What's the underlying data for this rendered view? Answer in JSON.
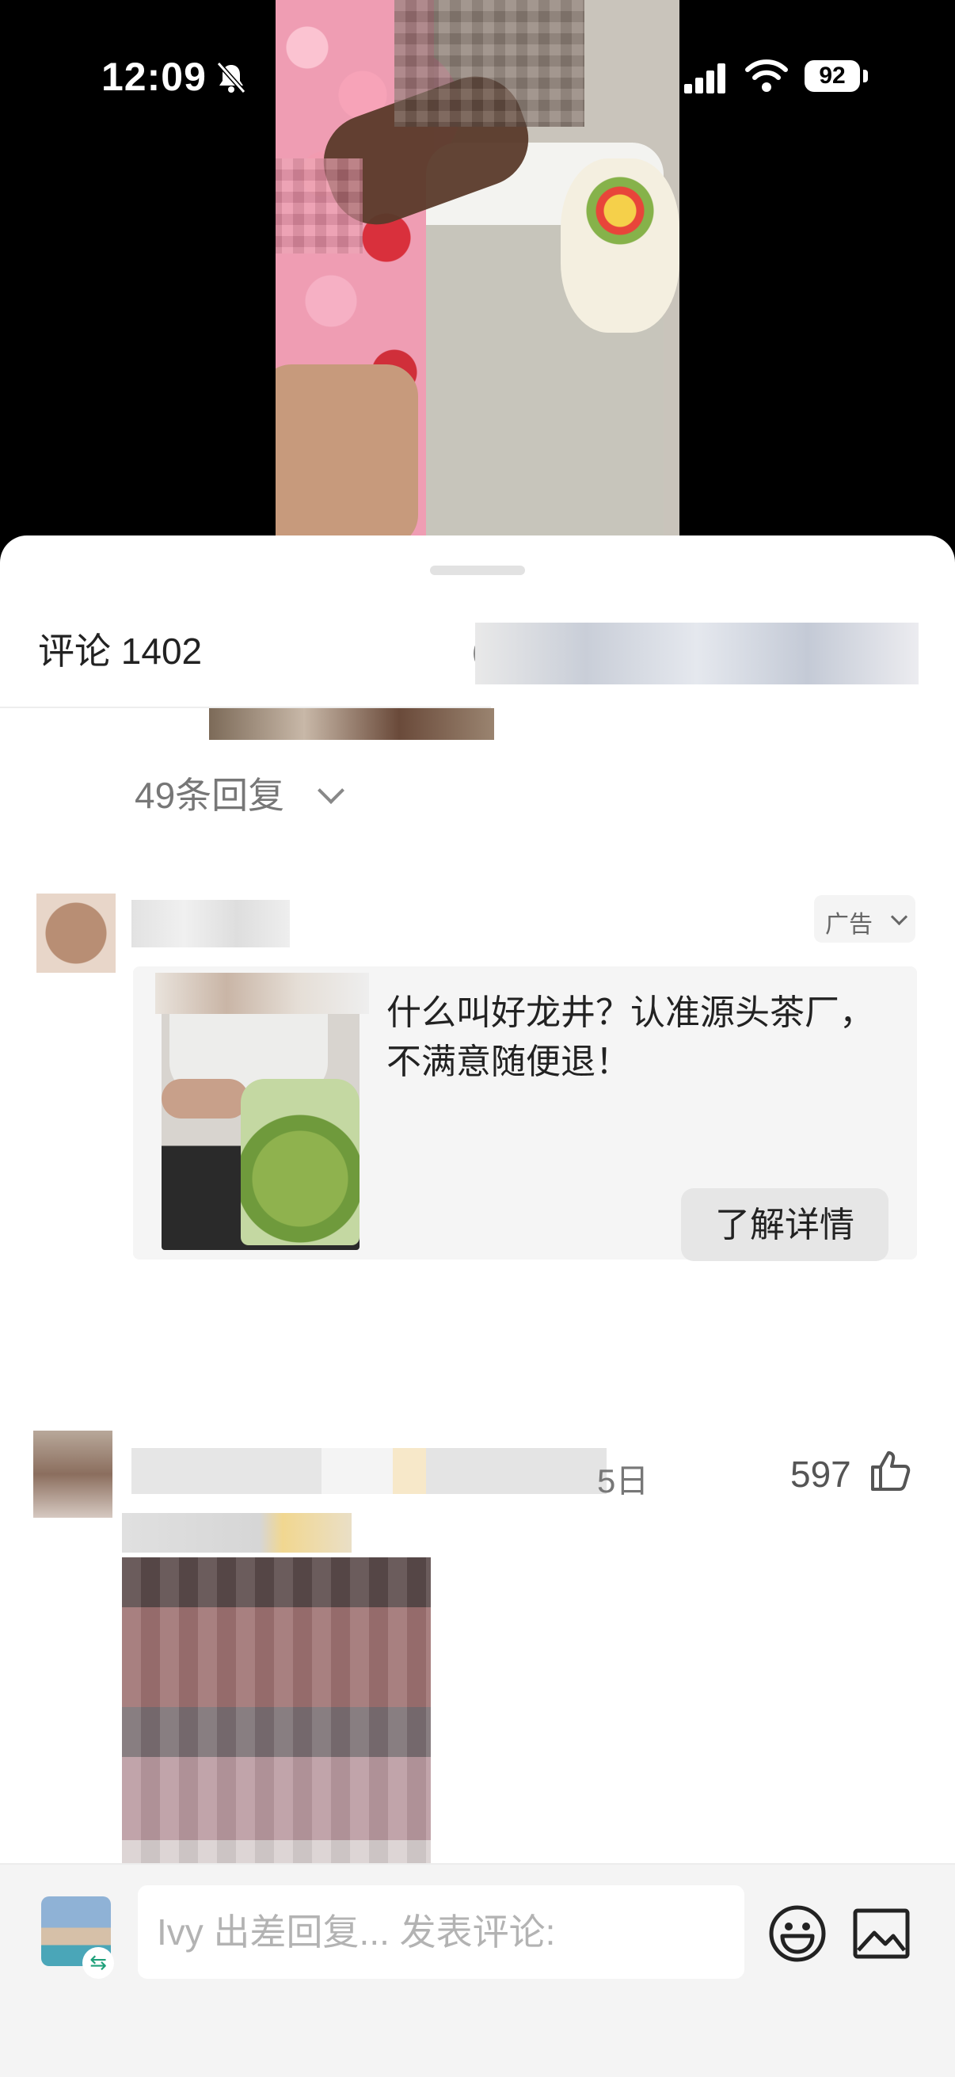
{
  "status_bar": {
    "time": "12:09",
    "battery": "92",
    "icons": [
      "bell-slash-icon",
      "signal-icon",
      "wifi-icon",
      "battery-icon"
    ]
  },
  "comments_sheet": {
    "title": "评论 1402"
  },
  "reply_toggle": {
    "label": "49条回复"
  },
  "ad": {
    "tag": "广告",
    "text": "什么叫好龙井？认准源头茶厂，不满意随便退！",
    "button": "了解详情"
  },
  "comment2": {
    "date_tail": "5日",
    "likes": "597"
  },
  "composer": {
    "placeholder": "Ivy 出差回复... 发表评论:",
    "icons": [
      "emoji-icon",
      "image-icon"
    ]
  },
  "colors": {
    "sheet_bg": "#ffffff",
    "bar_bg": "#f4f4f4",
    "text_primary": "#222222",
    "text_secondary": "#777777"
  }
}
